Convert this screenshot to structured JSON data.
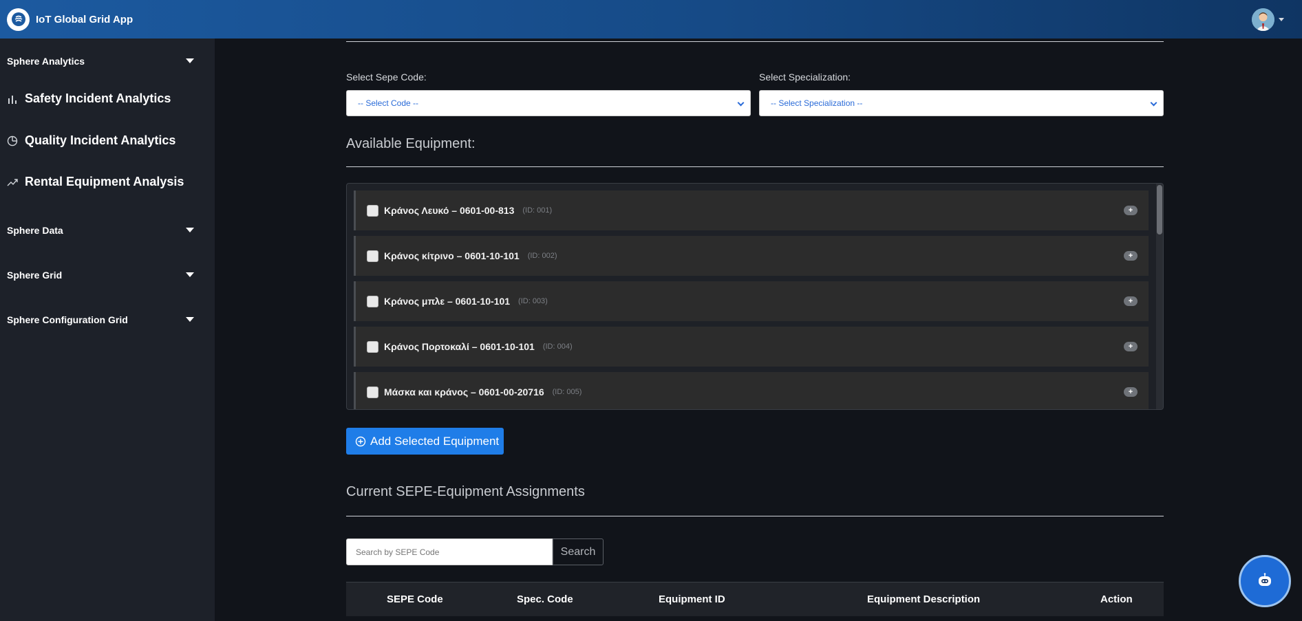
{
  "app": {
    "title": "IoT Global Grid App"
  },
  "sidebar": {
    "sections": [
      {
        "label": "Sphere Analytics"
      },
      {
        "label": "Sphere Data"
      },
      {
        "label": "Sphere Grid"
      },
      {
        "label": "Sphere Configuration Grid"
      }
    ],
    "items": [
      {
        "label": "Safety Incident Analytics",
        "icon": "bar-chart-icon"
      },
      {
        "label": "Quality Incident Analytics",
        "icon": "pie-chart-icon"
      },
      {
        "label": "Rental Equipment Analysis",
        "icon": "trend-up-icon"
      }
    ]
  },
  "filters": {
    "sepe_label": "Select Sepe Code:",
    "sepe_value": "-- Select Code --",
    "spec_label": "Select Specialization:",
    "spec_value": "-- Select Specialization --"
  },
  "equipment": {
    "title": "Available Equipment:",
    "items": [
      {
        "name": "Κράνος Λευκό – 0601-00-813",
        "id": "(ID: 001)"
      },
      {
        "name": "Κράνος κίτρινο – 0601-10-101",
        "id": "(ID: 002)"
      },
      {
        "name": "Κράνος μπλε – 0601-10-101",
        "id": "(ID: 003)"
      },
      {
        "name": "Κράνος Πορτοκαλί – 0601-10-101",
        "id": "(ID: 004)"
      },
      {
        "name": "Μάσκα και κράνος – 0601-00-20716",
        "id": "(ID: 005)"
      }
    ],
    "add_label": "Add Selected Equipment"
  },
  "assignments": {
    "title": "Current SEPE-Equipment Assignments",
    "search_placeholder": "Search by SEPE Code",
    "search_label": "Search",
    "columns": [
      "SEPE Code",
      "Spec. Code",
      "Equipment ID",
      "Equipment Description",
      "Action"
    ]
  },
  "colors": {
    "header": "#1c5aa0",
    "sidebar": "#1d2129",
    "background": "#11141a",
    "primary": "#1f7de8"
  }
}
